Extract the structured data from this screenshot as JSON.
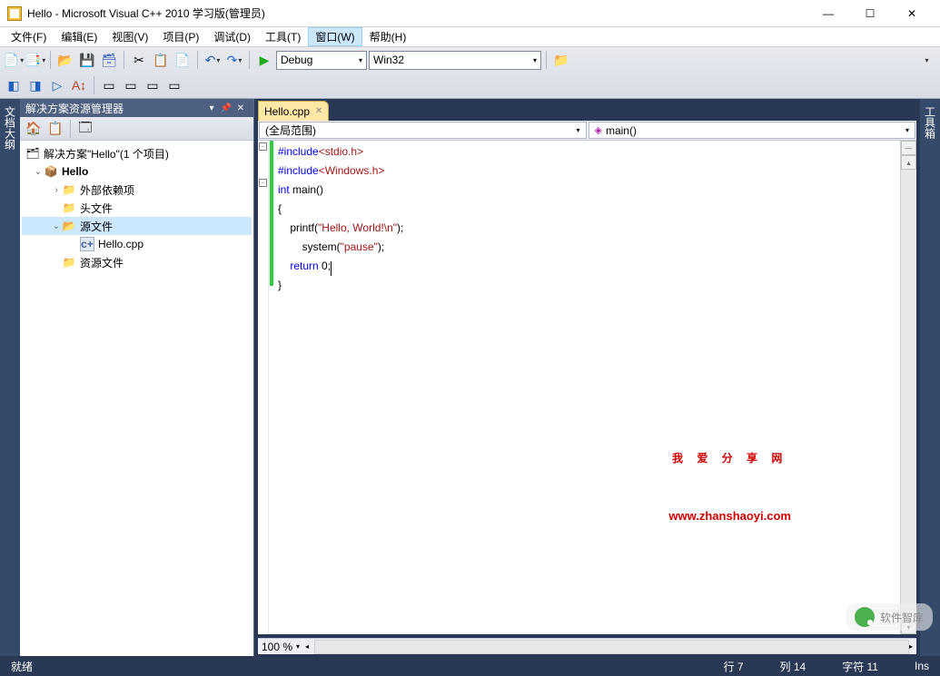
{
  "window": {
    "title": "Hello - Microsoft Visual C++ 2010 学习版(管理员)"
  },
  "menu": {
    "items": [
      "文件(F)",
      "编辑(E)",
      "视图(V)",
      "项目(P)",
      "调试(D)",
      "工具(T)",
      "窗口(W)",
      "帮助(H)"
    ],
    "active_index": 6
  },
  "toolbar": {
    "config_combo": "Debug",
    "platform_combo": "Win32"
  },
  "solution_explorer": {
    "title": "解决方案资源管理器",
    "root": "解决方案\"Hello\"(1 个项目)",
    "project": "Hello",
    "folders": {
      "external": "外部依赖项",
      "headers": "头文件",
      "sources": "源文件",
      "resources": "资源文件"
    },
    "source_file": "Hello.cpp"
  },
  "editor": {
    "tab_name": "Hello.cpp",
    "scope_combo": "(全局范围)",
    "member_combo": "main()",
    "zoom": "100 %",
    "code": {
      "l1_inc": "#include",
      "l1_hdr": "<stdio.h>",
      "l2_inc": "#include",
      "l2_hdr": "<Windows.h>",
      "l3_a": "int",
      "l3_b": " main()",
      "l4": "{",
      "l5_a": "    printf(",
      "l5_b": "\"Hello, World!\\n\"",
      "l5_c": ");",
      "l6_a": "        system(",
      "l6_b": "\"pause\"",
      "l6_c": ");",
      "l7_a": "    ",
      "l7_b": "return",
      "l7_c": " 0;",
      "l8": "}"
    }
  },
  "watermark": {
    "text": "我 爱 分 享 网",
    "url": "www.zhanshaoyi.com"
  },
  "status": {
    "ready": "就绪",
    "line": "行 7",
    "col": "列 14",
    "char": "字符 11",
    "ins": "Ins"
  },
  "side_tabs": {
    "left": "文档大纲",
    "right": "工具箱"
  },
  "bottom_logo": "软件智库"
}
